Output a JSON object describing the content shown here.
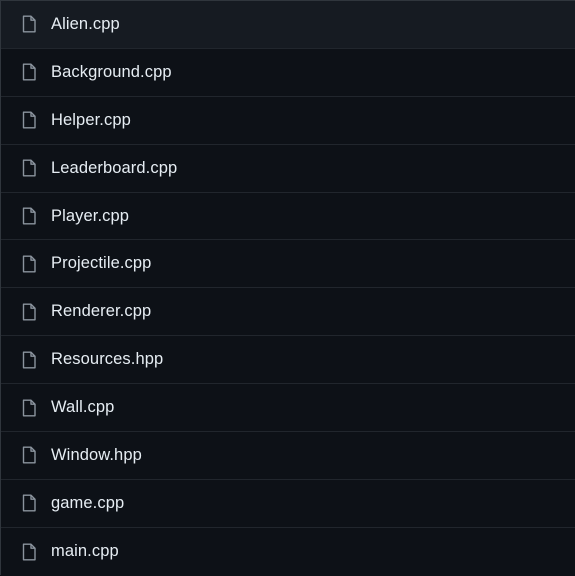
{
  "files": [
    {
      "name": "Alien.cpp",
      "icon": "file-icon"
    },
    {
      "name": "Background.cpp",
      "icon": "file-icon"
    },
    {
      "name": "Helper.cpp",
      "icon": "file-icon"
    },
    {
      "name": "Leaderboard.cpp",
      "icon": "file-icon"
    },
    {
      "name": "Player.cpp",
      "icon": "file-icon"
    },
    {
      "name": "Projectile.cpp",
      "icon": "file-icon"
    },
    {
      "name": "Renderer.cpp",
      "icon": "file-icon"
    },
    {
      "name": "Resources.hpp",
      "icon": "file-icon"
    },
    {
      "name": "Wall.cpp",
      "icon": "file-icon"
    },
    {
      "name": "Window.hpp",
      "icon": "file-icon"
    },
    {
      "name": "game.cpp",
      "icon": "file-icon"
    },
    {
      "name": "main.cpp",
      "icon": "file-icon"
    }
  ],
  "colors": {
    "background": "#0d1117",
    "row_hover": "#161b22",
    "border": "#21262d",
    "text": "#e6edf3",
    "icon": "#8b949e"
  }
}
